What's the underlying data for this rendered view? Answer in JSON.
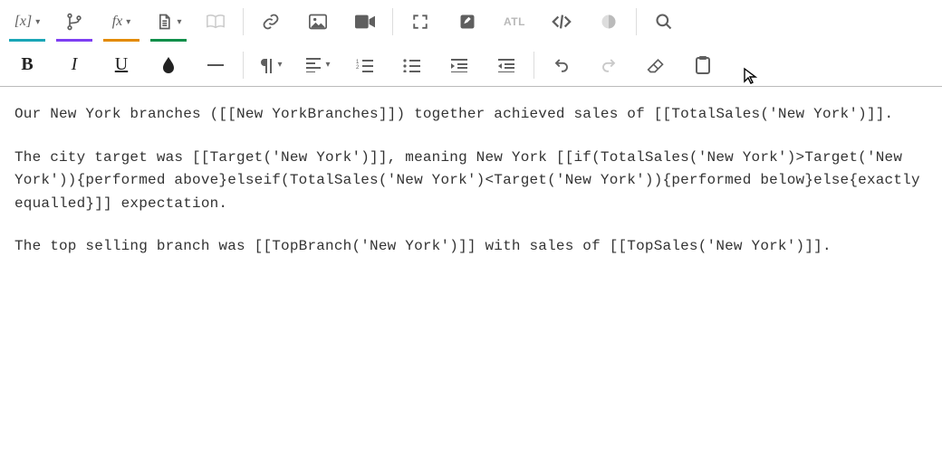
{
  "toolbar": {
    "row1": {
      "field_label": "[x]",
      "branch_label": "",
      "fx_label": "fx",
      "atl_label": "ATL"
    },
    "row2": {
      "bold": "B",
      "italic": "I",
      "underline": "U"
    },
    "accents": {
      "field": "#1aa6b7",
      "branch": "#7e3ff2",
      "fx": "#e38b00",
      "doc": "#0f8f4a",
      "book": "#e0b84a"
    }
  },
  "editor": {
    "p1": "Our New York branches ([[New YorkBranches]]) together achieved sales of [[TotalSales('New York')]].",
    "p2": "The city target was [[Target('New York')]], meaning New York [[if(TotalSales('New York')>Target('New York')){performed above}elseif(TotalSales('New York')<Target('New York')){performed below}else{exactly equalled}]] expectation.",
    "p3": "The top selling branch was [[TopBranch('New York')]] with sales of [[TopSales('New York')]]."
  }
}
